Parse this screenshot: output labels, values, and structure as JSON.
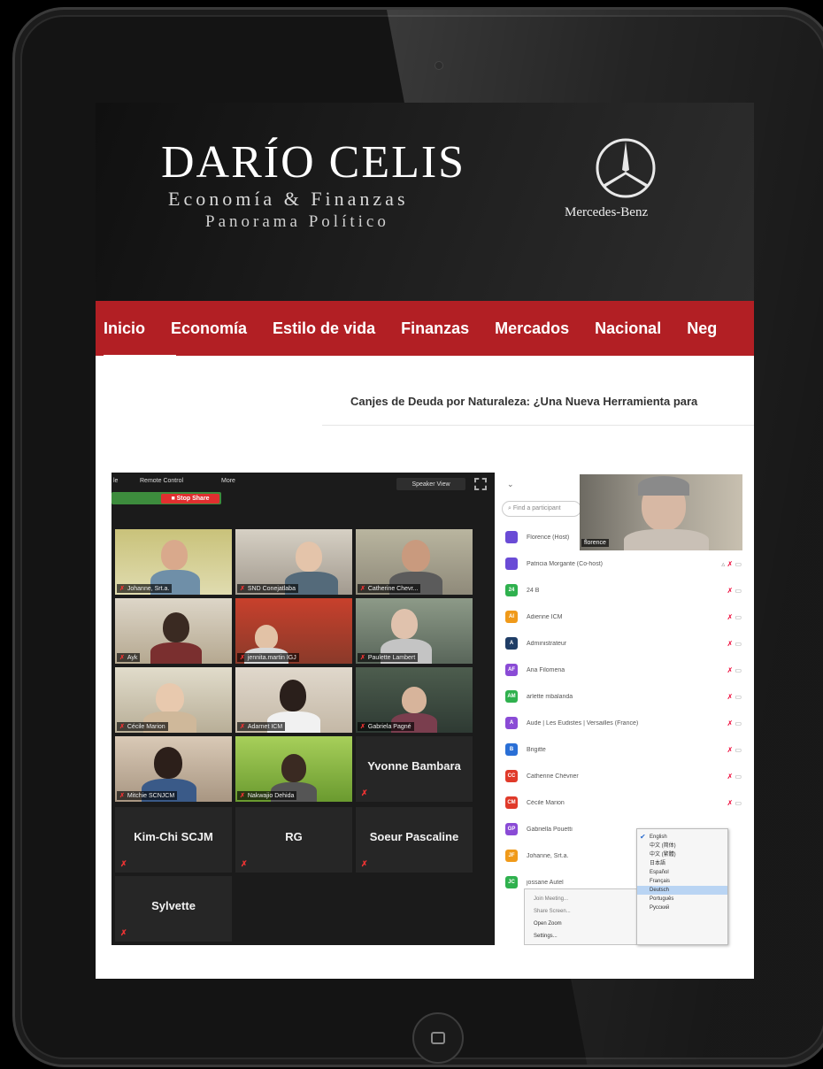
{
  "site": {
    "brand_title": "DARÍO CELIS",
    "brand_subtitle_1": "Economía & Finanzas",
    "brand_subtitle_2": "Panorama Político",
    "sponsor_name": "Mercedes-Benz",
    "sponsor_icon": "mercedes-star-icon"
  },
  "nav": {
    "items": [
      {
        "label": "Inicio"
      },
      {
        "label": "Economía"
      },
      {
        "label": "Estilo de vida"
      },
      {
        "label": "Finanzas"
      },
      {
        "label": "Mercados"
      },
      {
        "label": "Nacional"
      },
      {
        "label": "Neg"
      }
    ],
    "active": "Inicio",
    "background": "#b21f24"
  },
  "ticker": {
    "headline": "Canjes de Deuda por Naturaleza: ¿Una Nueva Herramienta para"
  },
  "zoom": {
    "toolbar": {
      "menu_items": [
        "le",
        "Remote Control",
        "More"
      ],
      "stop_share": "■ Stop Share",
      "speaker_view": "Speaker View"
    },
    "gallery": [
      {
        "name": "Johanne, Srt.a."
      },
      {
        "name": "SND Conejatlaba"
      },
      {
        "name": "Catherine Chevr..."
      },
      {
        "name": "Ayk"
      },
      {
        "name": "jennita.martin IGJ"
      },
      {
        "name": "Paulette Lambert"
      },
      {
        "name": "Cécile Marion"
      },
      {
        "name": "Adarnet ICM"
      },
      {
        "name": "Gabriela Pagné"
      },
      {
        "name": "Mitchie SCNJCM"
      },
      {
        "name": "Nakwajio Dehida"
      },
      {
        "name": "Yvonne Bambara"
      },
      {
        "name": "Kim-Chi SCJM"
      },
      {
        "name": "RG"
      },
      {
        "name": "Soeur Pascaline"
      },
      {
        "name": "Sylvette"
      }
    ],
    "participants_panel": {
      "search_placeholder": "Find a participant",
      "speaker_name": "florence",
      "participants": [
        {
          "initials": "",
          "name": "Florence (Host)",
          "color": "#6a4bd6"
        },
        {
          "initials": "",
          "name": "Patricia Morgante (Co-host)",
          "color": "#6a4bd6"
        },
        {
          "initials": "24",
          "name": "24 B",
          "color": "#2fb14e"
        },
        {
          "initials": "AI",
          "name": "Adienne ICM",
          "color": "#f09a1a"
        },
        {
          "initials": "A",
          "name": "Administrateur",
          "color": "#1f3d66"
        },
        {
          "initials": "AF",
          "name": "Ana Filomena",
          "color": "#8a4bd6"
        },
        {
          "initials": "AM",
          "name": "arlette mbalanda",
          "color": "#2fb14e"
        },
        {
          "initials": "A",
          "name": "Aude | Les Eudistes | Versailles (France)",
          "color": "#8a4bd6"
        },
        {
          "initials": "B",
          "name": "Brigitte",
          "color": "#2a6fd6"
        },
        {
          "initials": "CC",
          "name": "Catherine Chévrier",
          "color": "#e03a2a"
        },
        {
          "initials": "CM",
          "name": "Cécile Marion",
          "color": "#e03a2a"
        },
        {
          "initials": "GP",
          "name": "Gabriella Pouetti",
          "color": "#8a4bd6"
        },
        {
          "initials": "JF",
          "name": "Johanne, Srt.a.",
          "color": "#f09a1a"
        },
        {
          "initials": "JC",
          "name": "jossane Autel",
          "color": "#2fb14e"
        }
      ]
    },
    "language_menu": [
      "English",
      "中文 (简体)",
      "中文 (繁體)",
      "日本語",
      "Español",
      "Français",
      "Deutsch",
      "Português",
      "Русский"
    ],
    "language_selected": "Deutsch",
    "language_checked": "English",
    "context_menu": [
      "Join Meeting...",
      "Share Screen...",
      "Open Zoom",
      "Settings..."
    ]
  }
}
